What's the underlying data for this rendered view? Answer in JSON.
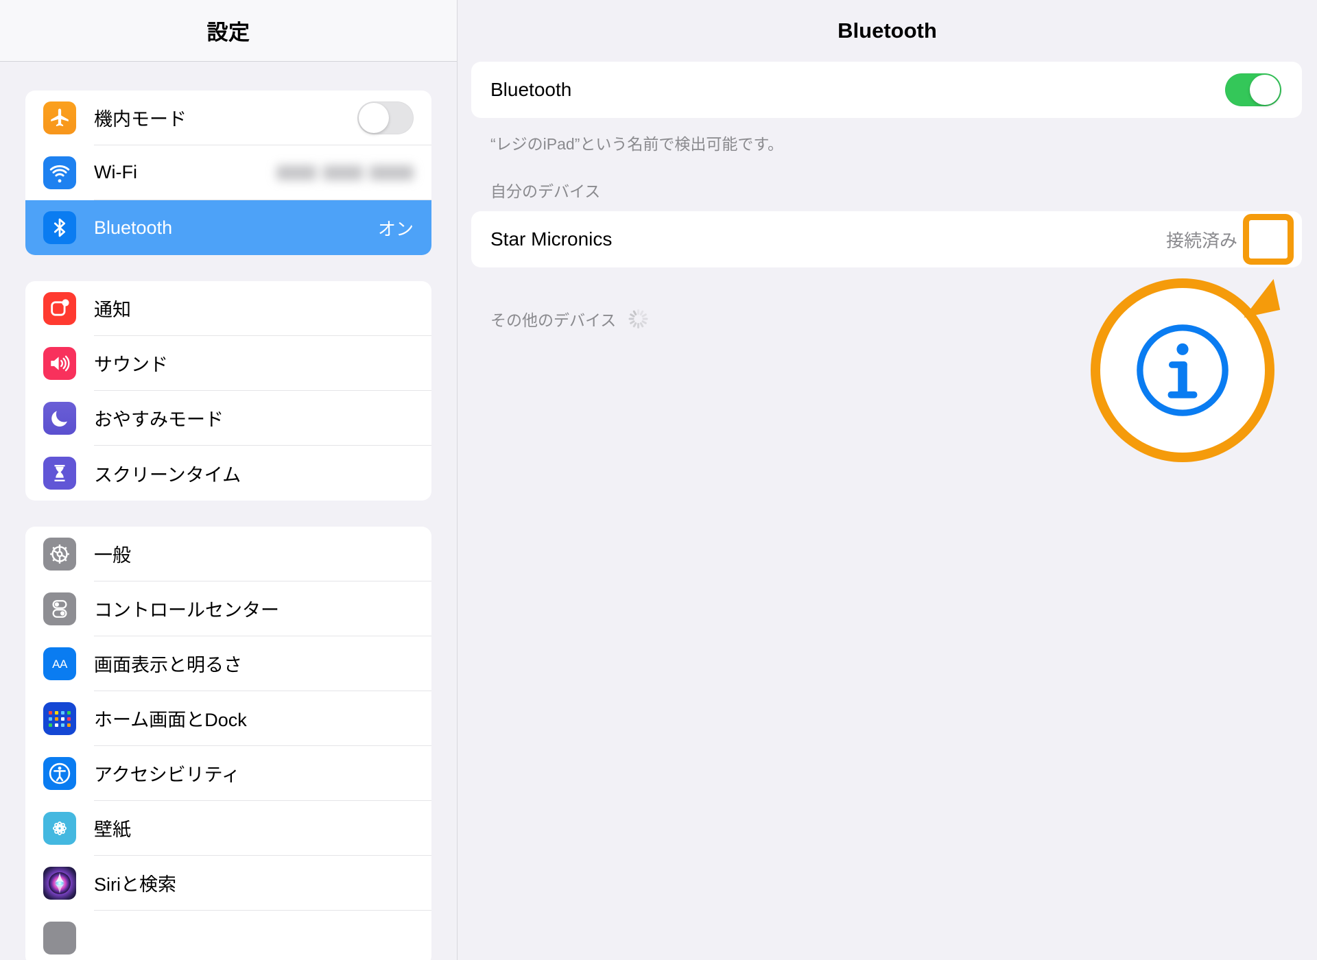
{
  "sidebar": {
    "title": "設定",
    "groups": [
      {
        "items": [
          {
            "label": "機内モード",
            "icon": "airplane-icon",
            "control": "toggle",
            "toggle_on": false,
            "value": ""
          },
          {
            "label": "Wi-Fi",
            "icon": "wifi-icon",
            "control": "value-blurred",
            "value": "atom-14x183-a"
          },
          {
            "label": "Bluetooth",
            "icon": "bluetooth-icon",
            "control": "value",
            "value": "オン",
            "selected": true
          }
        ]
      },
      {
        "items": [
          {
            "label": "通知",
            "icon": "notifications-icon",
            "control": "none",
            "value": ""
          },
          {
            "label": "サウンド",
            "icon": "sound-icon",
            "control": "none",
            "value": ""
          },
          {
            "label": "おやすみモード",
            "icon": "do-not-disturb-icon",
            "control": "none",
            "value": ""
          },
          {
            "label": "スクリーンタイム",
            "icon": "screen-time-icon",
            "control": "none",
            "value": ""
          }
        ]
      },
      {
        "items": [
          {
            "label": "一般",
            "icon": "general-gear-icon",
            "control": "none",
            "value": ""
          },
          {
            "label": "コントロールセンター",
            "icon": "control-center-icon",
            "control": "none",
            "value": ""
          },
          {
            "label": "画面表示と明るさ",
            "icon": "display-brightness-icon",
            "control": "none",
            "value": ""
          },
          {
            "label": "ホーム画面とDock",
            "icon": "home-screen-dock-icon",
            "control": "none",
            "value": ""
          },
          {
            "label": "アクセシビリティ",
            "icon": "accessibility-icon",
            "control": "none",
            "value": ""
          },
          {
            "label": "壁紙",
            "icon": "wallpaper-icon",
            "control": "none",
            "value": ""
          },
          {
            "label": "Siriと検索",
            "icon": "siri-search-icon",
            "control": "none",
            "value": ""
          }
        ]
      }
    ]
  },
  "detail": {
    "title": "Bluetooth",
    "bluetooth_label": "Bluetooth",
    "bluetooth_on": true,
    "caption": "“レジのiPad”という名前で検出可能です。",
    "my_devices_heading": "自分のデバイス",
    "devices": [
      {
        "name": "Star Micronics",
        "status": "接続済み",
        "info": "info-icon"
      }
    ],
    "other_devices_heading": "その他のデバイス"
  },
  "annotation": {
    "highlight_color": "#F59B0B",
    "info_icon_color": "#0A7CF1",
    "callout_icon": "info-icon"
  },
  "colors": {
    "accent_blue": "#0A7CF1",
    "selected_row": "#4DA2F8",
    "toggle_on_green": "#34C759",
    "background": "#F2F1F6",
    "card": "#FFFFFF",
    "secondary_text": "#8A8A8E"
  }
}
